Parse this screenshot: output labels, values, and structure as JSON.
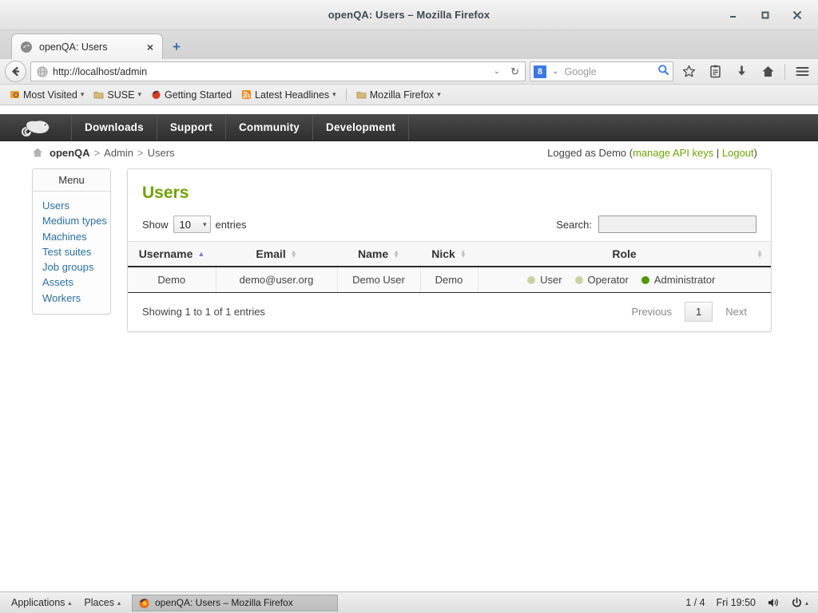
{
  "window": {
    "title": "openQA: Users – Mozilla Firefox",
    "minimize_label": "minimize-icon",
    "maximize_label": "maximize-icon",
    "close_label": "close-icon"
  },
  "browser": {
    "tab": {
      "title": "openQA: Users",
      "close_label": "×",
      "favicon_name": "openqa-favicon"
    },
    "new_tab_label": "+",
    "back_label": "←",
    "url": "http://localhost/admin",
    "url_dropdown_label": "⌄",
    "reload_label": "↻",
    "search": {
      "engine_glyph": "8",
      "engine_dropdown": "⌄",
      "placeholder": "Google",
      "go_icon": "magnifier-icon"
    },
    "toolbar_icons": [
      "bookmark-star-icon",
      "reader-list-icon",
      "downloads-icon",
      "home-icon",
      "menu-hamburger-icon"
    ],
    "bookmarks": [
      {
        "label": "Most Visited",
        "icon": "most-visited-icon",
        "dropdown": true
      },
      {
        "label": "SUSE",
        "icon": "folder-icon",
        "dropdown": true
      },
      {
        "label": "Getting Started",
        "icon": "firefox-icon",
        "dropdown": false
      },
      {
        "label": "Latest Headlines",
        "icon": "rss-icon",
        "dropdown": true
      },
      {
        "label": "Mozilla Firefox",
        "icon": "folder-icon",
        "dropdown": true
      }
    ]
  },
  "site": {
    "logo_name": "opensuse-chameleon-logo",
    "nav": [
      "Downloads",
      "Support",
      "Community",
      "Development"
    ],
    "breadcrumb": {
      "home_icon": "home-icon",
      "root": "openQA",
      "separator": ">",
      "items": [
        "Admin",
        "Users"
      ]
    },
    "user_bar": {
      "prefix": "Logged as Demo (",
      "api_keys_link": "manage API keys",
      "divider": " | ",
      "logout_link": "Logout",
      "suffix": ")"
    }
  },
  "sidebar": {
    "heading": "Menu",
    "items": [
      {
        "label": "Users"
      },
      {
        "label": "Medium types"
      },
      {
        "label": "Machines"
      },
      {
        "label": "Test suites"
      },
      {
        "label": "Job groups"
      },
      {
        "label": "Assets"
      },
      {
        "label": "Workers"
      }
    ]
  },
  "main": {
    "title": "Users",
    "show_prefix": "Show",
    "page_length": "10",
    "show_suffix": "entries",
    "search_label": "Search:",
    "search_value": "",
    "search_placeholder": "",
    "columns": [
      {
        "label": "Username",
        "sort": "asc"
      },
      {
        "label": "Email",
        "sort": "none"
      },
      {
        "label": "Name",
        "sort": "none"
      },
      {
        "label": "Nick",
        "sort": "none"
      },
      {
        "label": "Role",
        "sort": "none"
      }
    ],
    "rows": [
      {
        "username": "Demo",
        "email": "demo@user.org",
        "name": "Demo User",
        "nick": "Demo",
        "roles": [
          {
            "label": "User",
            "active": false
          },
          {
            "label": "Operator",
            "active": false
          },
          {
            "label": "Administrator",
            "active": true
          }
        ]
      }
    ],
    "info": "Showing 1 to 1 of 1 entries",
    "pagination": {
      "previous": "Previous",
      "current": "1",
      "next": "Next"
    }
  },
  "taskbar": {
    "applications": "Applications",
    "places": "Places",
    "caret": "▴",
    "window_button": "openQA: Users – Mozilla Firefox",
    "workspace": "1 / 4",
    "clock": "Fri 19:50",
    "volume_icon": "volume-icon",
    "power_icon": "power-icon"
  },
  "colors": {
    "brand_green": "#6ea204",
    "link_blue": "#2b6f9e",
    "role_active": "#4e9a06",
    "role_inactive": "#c8d4a4",
    "sort_active": "#7b7bd9"
  }
}
